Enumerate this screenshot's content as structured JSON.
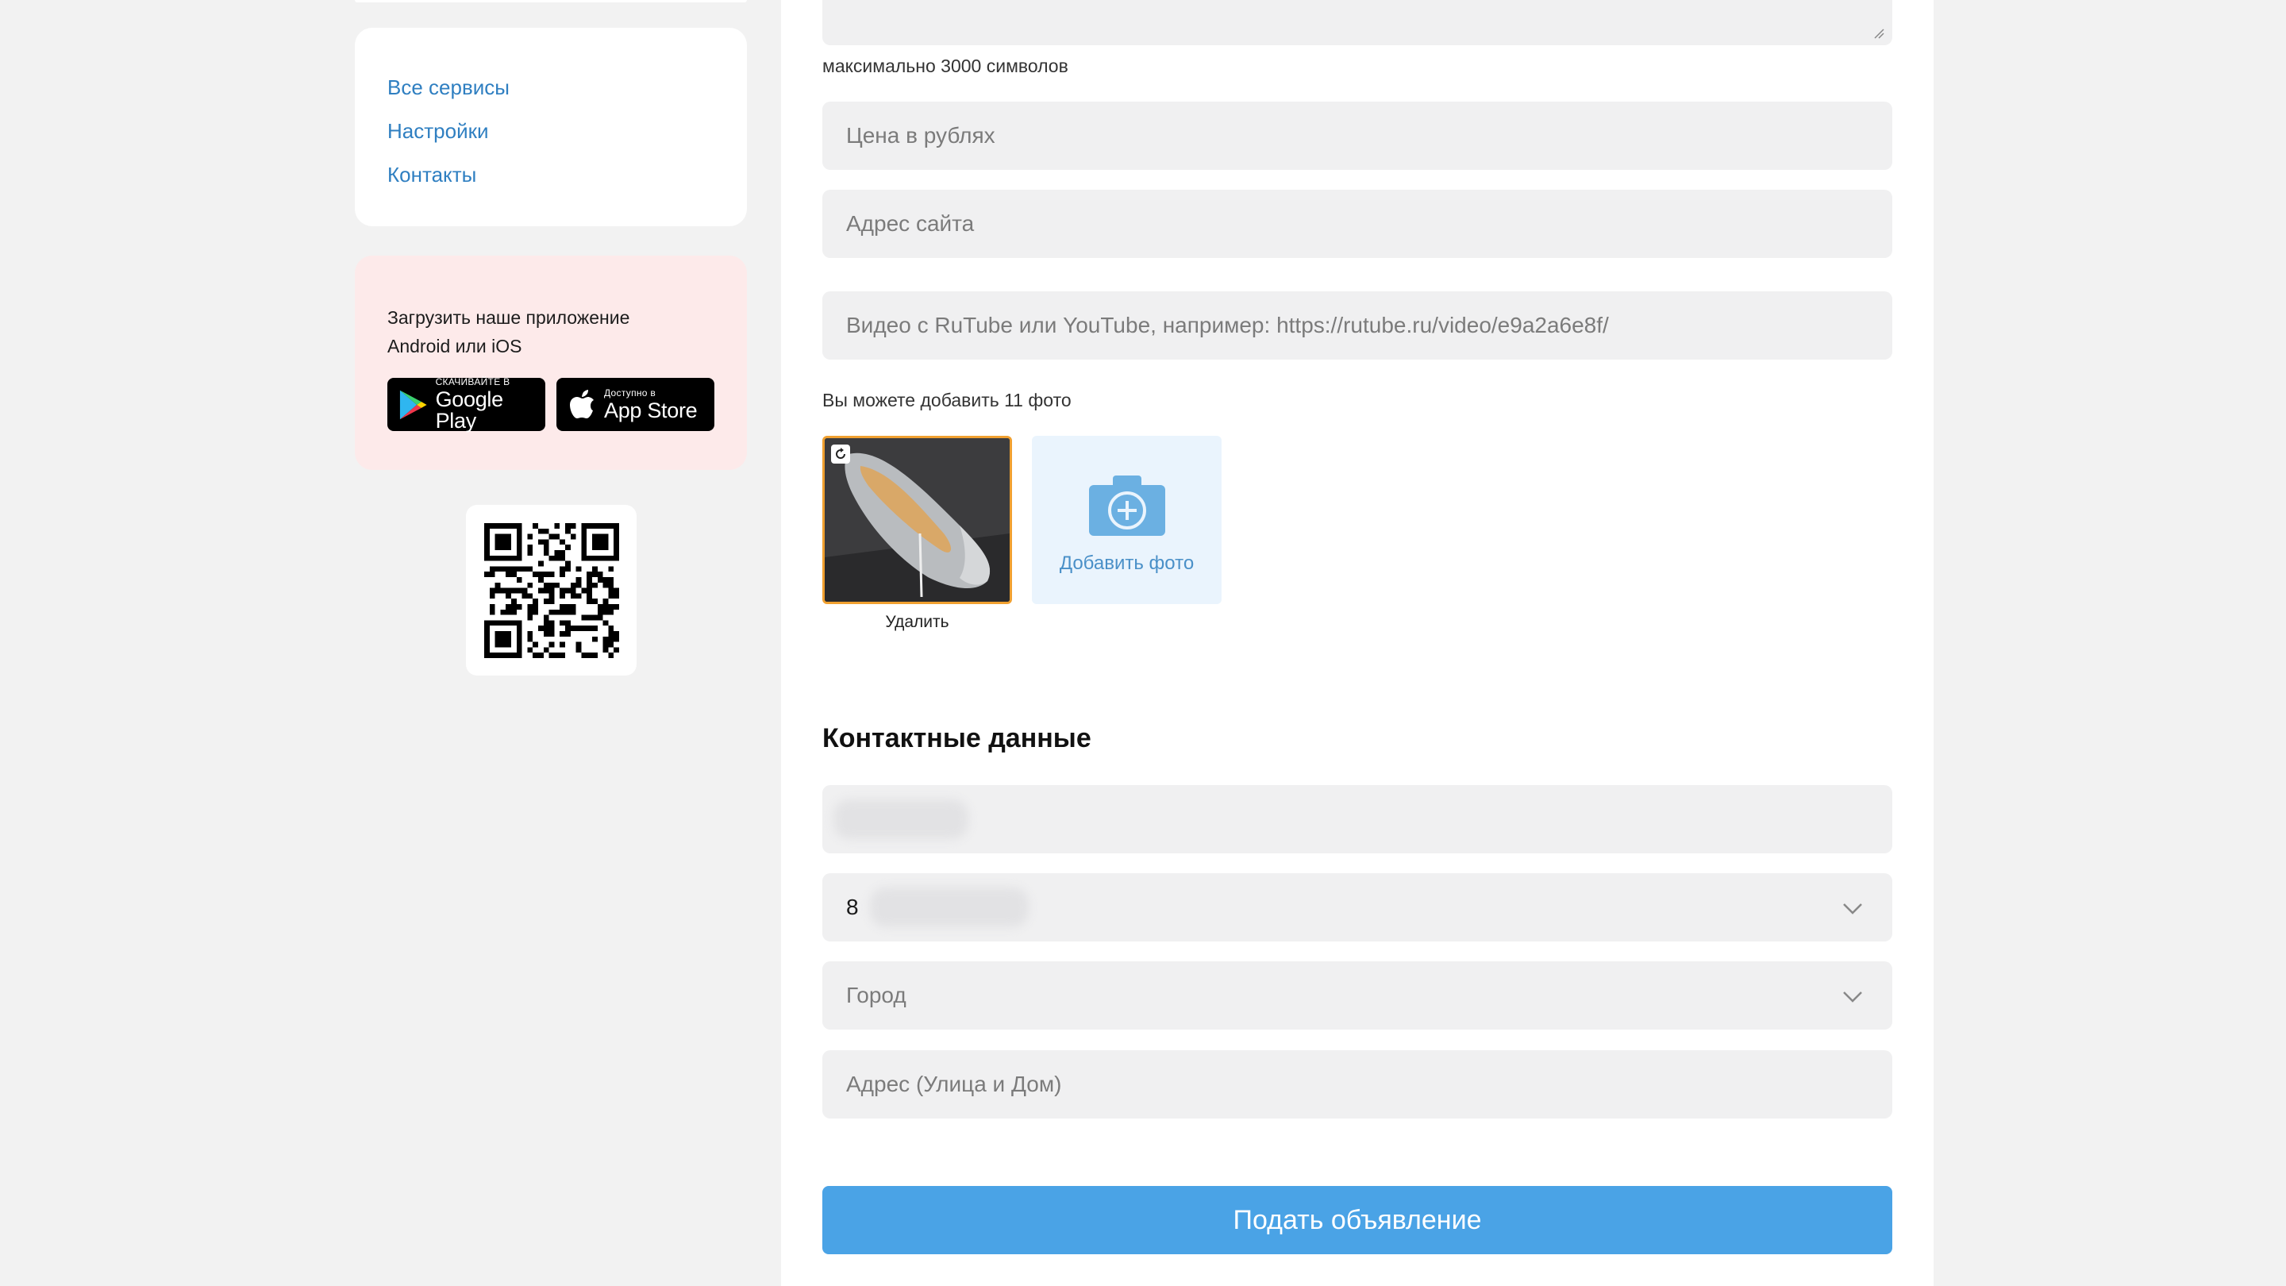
{
  "sidebar": {
    "nav_links": [
      "Все сервисы",
      "Настройки",
      "Контакты"
    ],
    "app_promo": {
      "text": "Загрузить наше приложение Android или iOS",
      "google_play": {
        "small": "СКАЧИВАЙТЕ В",
        "big": "Google Play"
      },
      "app_store": {
        "small": "Доступно в",
        "big": "App Store"
      }
    }
  },
  "form": {
    "description_hint": "максимально 3000 символов",
    "price_placeholder": "Цена в рублях",
    "site_placeholder": "Адрес сайта",
    "video_placeholder": "Видео с RuTube или YouTube, например: https://rutube.ru/video/e9a2a6e8f/",
    "photos_hint": "Вы можете добавить 11 фото",
    "delete_label": "Удалить",
    "add_photo_label": "Добавить фото",
    "contacts_title": "Контактные данные",
    "phone_prefix": "8",
    "city_placeholder": "Город",
    "address_placeholder": "Адрес (Улица и Дом)",
    "submit_label": "Подать объявление"
  },
  "colors": {
    "link": "#2f7fc1",
    "accent": "#4aa3e6",
    "promo_bg": "#fdeaea",
    "field_bg": "#f0f0f1",
    "thumb_border": "#f0a030"
  }
}
